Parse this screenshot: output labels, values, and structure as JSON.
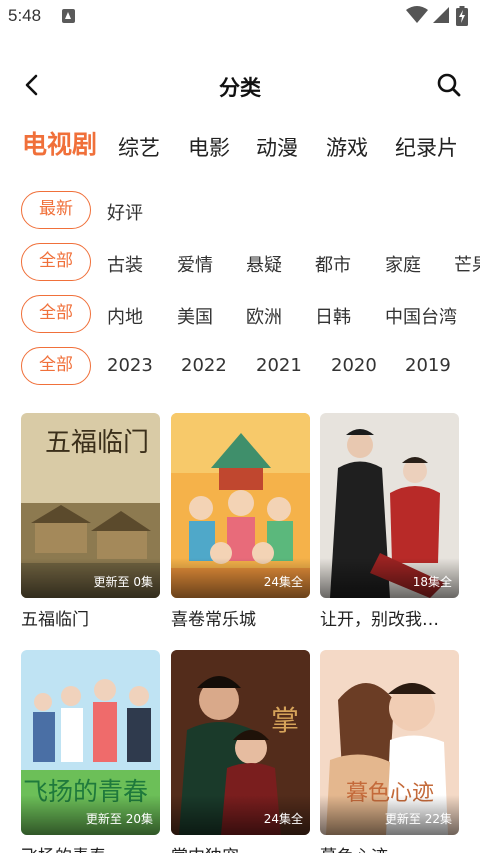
{
  "status": {
    "time": "5:48"
  },
  "header": {
    "title": "分类"
  },
  "tabs": [
    "电视剧",
    "综艺",
    "电影",
    "动漫",
    "游戏",
    "纪录片"
  ],
  "filters": {
    "sort": {
      "selected": "最新",
      "options": [
        "好评"
      ]
    },
    "genre": {
      "selected": "全部",
      "options": [
        "古装",
        "爱情",
        "悬疑",
        "都市",
        "家庭",
        "芒果"
      ]
    },
    "region": {
      "selected": "全部",
      "options": [
        "内地",
        "美国",
        "欧洲",
        "日韩",
        "中国台湾"
      ]
    },
    "year": {
      "selected": "全部",
      "options": [
        "2023",
        "2022",
        "2021",
        "2020",
        "2019"
      ]
    }
  },
  "shows": [
    {
      "title": "五福临门",
      "badge": "更新至 0集",
      "poster_text": "五福临门"
    },
    {
      "title": "喜卷常乐城",
      "badge": "24集全",
      "poster_text": ""
    },
    {
      "title": "让开，别改我…",
      "badge": "18集全",
      "poster_text": ""
    },
    {
      "title": "飞扬的青春",
      "badge": "更新至 20集",
      "poster_text": "飞扬的青春"
    },
    {
      "title": "掌中独宠",
      "badge": "24集全",
      "poster_text": "掌"
    },
    {
      "title": "暮色心迹",
      "badge": "更新至 22集",
      "poster_text": "暮色心迹"
    }
  ],
  "colors": {
    "accent": "#f0703a",
    "text": "#222222"
  }
}
